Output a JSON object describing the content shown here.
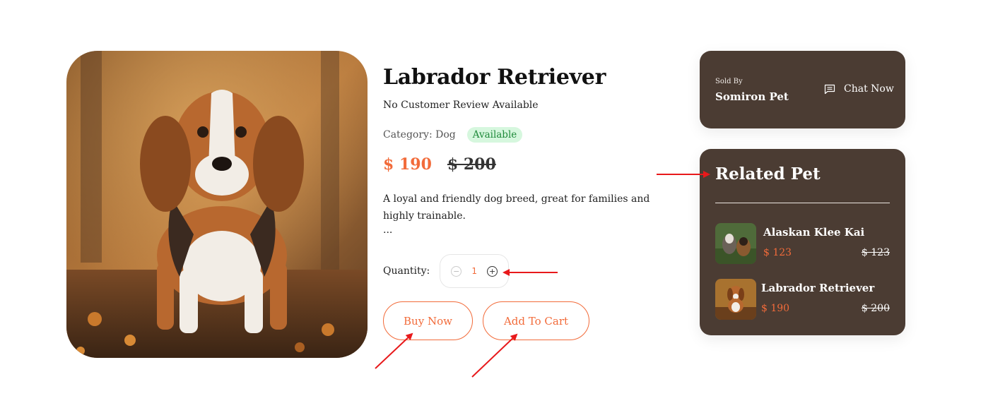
{
  "product": {
    "title": "Labrador Retriever",
    "review_text": "No Customer Review Available",
    "category_text": "Category: Dog",
    "availability_badge": "Available",
    "price": "$ 190",
    "old_price": "$ 200",
    "description": "A loyal and friendly dog breed, great for families and highly trainable.",
    "description_ellipsis": "...",
    "quantity_label": "Quantity:",
    "quantity_value": "1",
    "buy_now_label": "Buy Now",
    "add_to_cart_label": "Add To Cart"
  },
  "seller": {
    "sold_by_label": "Sold By",
    "name": "Somiron Pet",
    "chat_label": "Chat Now"
  },
  "related": {
    "title": "Related Pet",
    "items": [
      {
        "name": "Alaskan Klee Kai",
        "price": "$ 123",
        "old_price": "$ 123"
      },
      {
        "name": "Labrador Retriever",
        "price": "$ 190",
        "old_price": "$ 200"
      }
    ]
  },
  "colors": {
    "accent": "#f26b3a",
    "panel_bg": "#4b3c33",
    "badge_bg": "#d6f7de",
    "badge_text": "#1f8a3a",
    "annotation_arrow": "#e8191b"
  },
  "icons": {
    "minus": "minus-circle-icon",
    "plus": "plus-circle-icon",
    "chat": "chat-icon"
  }
}
